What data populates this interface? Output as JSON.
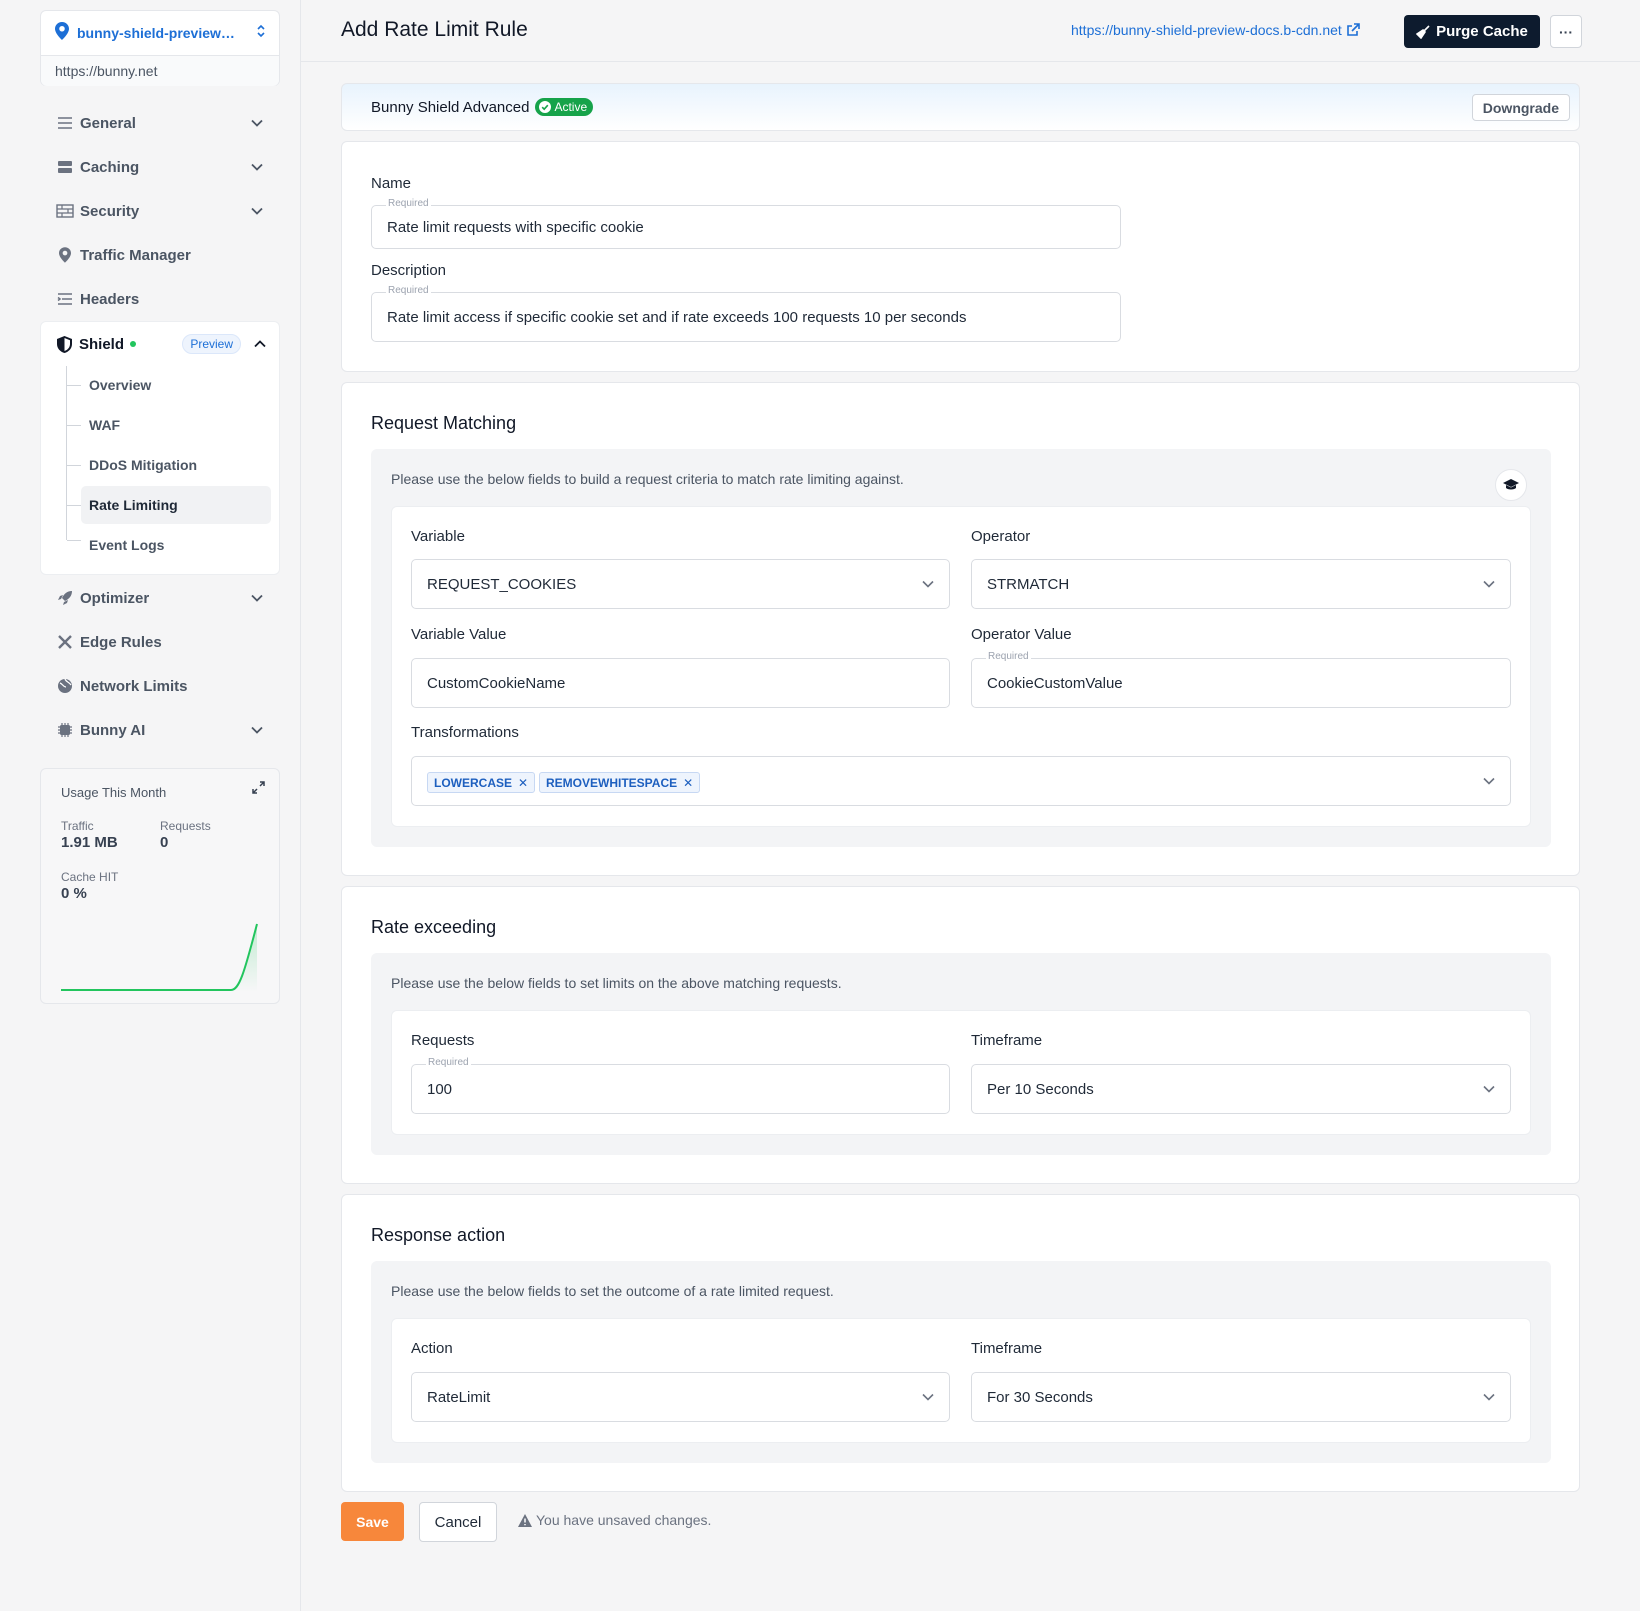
{
  "sidebar": {
    "zone": {
      "name": "bunny-shield-preview…",
      "url": "https://bunny.net"
    },
    "items": [
      {
        "label": "General"
      },
      {
        "label": "Caching"
      },
      {
        "label": "Security"
      },
      {
        "label": "Traffic Manager"
      },
      {
        "label": "Headers"
      },
      {
        "label": "Optimizer"
      },
      {
        "label": "Edge Rules"
      },
      {
        "label": "Network Limits"
      },
      {
        "label": "Bunny AI"
      }
    ],
    "shield": {
      "label": "Shield",
      "badge": "Preview",
      "sub_items": [
        "Overview",
        "WAF",
        "DDoS Mitigation",
        "Rate Limiting",
        "Event Logs"
      ],
      "active": "Rate Limiting"
    },
    "usage": {
      "title": "Usage This Month",
      "traffic_label": "Traffic",
      "traffic_value": "1.91 MB",
      "requests_label": "Requests",
      "requests_value": "0",
      "cache_label": "Cache HIT",
      "cache_value": "0 %",
      "sparkline_color": "#22c55e"
    }
  },
  "header": {
    "title": "Add Rate Limit Rule",
    "link": "https://bunny-shield-preview-docs.b-cdn.net",
    "purge_label": "Purge Cache",
    "more_label": "···"
  },
  "plan": {
    "name": "Bunny Shield Advanced",
    "status": "Active",
    "downgrade_label": "Downgrade"
  },
  "general": {
    "name_label": "Name",
    "name_value": "Rate limit requests with specific cookie",
    "description_label": "Description",
    "description_value": "Rate limit access if specific cookie set and if rate exceeds 100 requests 10 per seconds",
    "required_tag": "Required"
  },
  "matching": {
    "title": "Request Matching",
    "hint": "Please use the below fields to build a request criteria to match rate limiting against.",
    "variable_label": "Variable",
    "variable_value": "REQUEST_COOKIES",
    "operator_label": "Operator",
    "operator_value": "STRMATCH",
    "variable_value_label": "Variable Value",
    "variable_value_value": "CustomCookieName",
    "operator_value_label": "Operator Value",
    "operator_value_value": "CookieCustomValue",
    "transformations_label": "Transformations",
    "transformations": [
      "LOWERCASE",
      "REMOVEWHITESPACE"
    ]
  },
  "rate": {
    "title": "Rate exceeding",
    "hint": "Please use the below fields to set limits on the above matching requests.",
    "requests_label": "Requests",
    "requests_value": "100",
    "timeframe_label": "Timeframe",
    "timeframe_value": "Per 10 Seconds"
  },
  "response": {
    "title": "Response action",
    "hint": "Please use the below fields to set the outcome of a rate limited request.",
    "action_label": "Action",
    "action_value": "RateLimit",
    "timeframe_label": "Timeframe",
    "timeframe_value": "For 30 Seconds"
  },
  "footer": {
    "save_label": "Save",
    "cancel_label": "Cancel",
    "unsaved_text": "You have unsaved changes."
  },
  "colors": {
    "brand_blue": "#1d6fd6",
    "save_orange": "#f7873b",
    "purge_dark": "#0d1b2e",
    "active_green": "#16a34a"
  }
}
